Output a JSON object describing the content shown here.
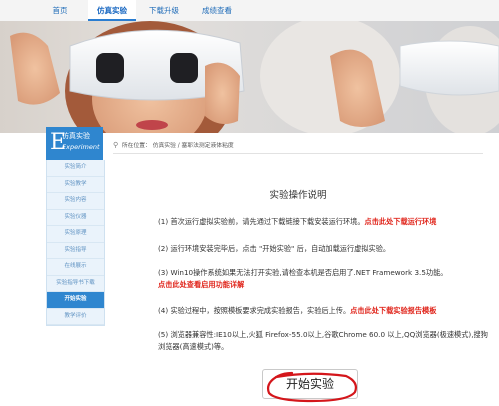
{
  "nav": {
    "items": [
      "首页",
      "仿真实验",
      "下载升级",
      "成绩查看"
    ]
  },
  "sidebar": {
    "header_cn": "仿真实验",
    "header_en": "Experiment",
    "items": [
      "实验简介",
      "实验教学",
      "实验内容",
      "实验仪器",
      "实验原理",
      "实验指导",
      "在线展示",
      "实验指导书下载",
      "开始实验",
      "教学评价"
    ],
    "active_index": 8
  },
  "breadcrumb": {
    "prefix": "所在位置：",
    "path": "仿真实验 / 塞耶法测定液体粘度"
  },
  "main": {
    "title": "实验操作说明",
    "p1_text": "(1) 首次运行虚拟实验前，请先通过下载链接下载安装运行环境。",
    "p1_link": "点击此处下载运行环境",
    "p2_text": "(2) 运行环境安装完毕后，点击 \"开始实验\" 后，自动加载运行虚拟实验。",
    "p3_text": "(3) Win10操作系统如果无法打开实验,请检查本机是否启用了.NET Framework 3.5功能。",
    "p3_link": "点击此处查看启用功能详解",
    "p4_text": "(4) 实验过程中，按照模板要求完成实验报告，实验后上传。",
    "p4_link": "点击此处下载实验报告模板",
    "p5_text": "(5) 浏览器兼容性:IE10以上,火狐 Firefox-55.0以上,谷歌Chrome 60.0 以上,QQ浏览器(极速模式),搜狗浏览器(高速模式)等。",
    "start_button": "开始实验"
  },
  "colors": {
    "accent": "#2f86cf",
    "link_red": "#e0251b",
    "annotation_red": "#d4161b"
  }
}
